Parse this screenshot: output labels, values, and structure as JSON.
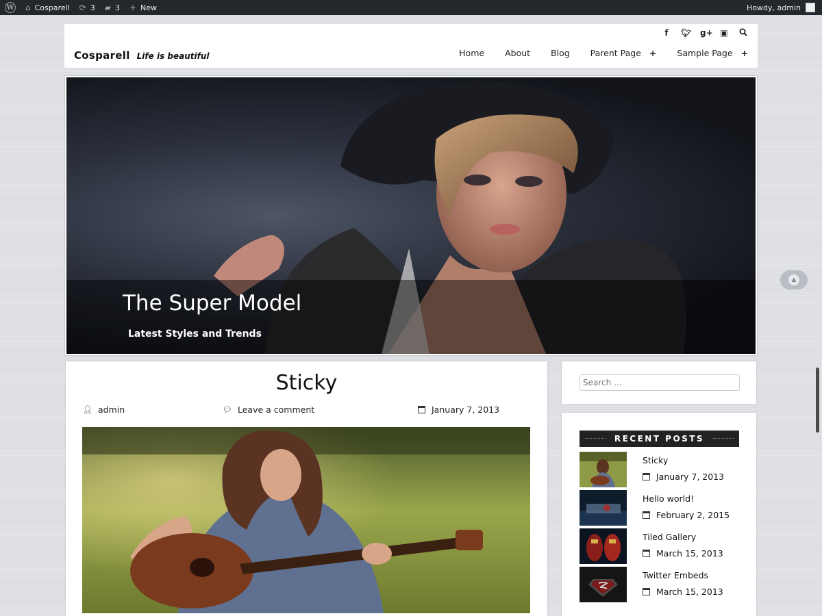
{
  "adminbar": {
    "site_name": "Cosparell",
    "updates_count": "3",
    "comments_count": "3",
    "new_label": "New",
    "greeting": "Howdy, admin"
  },
  "header": {
    "site_title": "Cosparell",
    "tagline": "Life is beautiful",
    "social_icons": [
      "facebook-icon",
      "twitter-icon",
      "google-plus-icon",
      "youtube-icon",
      "search-icon"
    ],
    "nav": [
      {
        "label": "Home"
      },
      {
        "label": "About"
      },
      {
        "label": "Blog"
      },
      {
        "label": "Parent Page",
        "expand": "+"
      },
      {
        "label": "Sample Page",
        "expand": "+"
      }
    ]
  },
  "hero": {
    "title": "The Super Model",
    "subtitle": "Latest Styles and Trends"
  },
  "post": {
    "title": "Sticky",
    "author": "admin",
    "comments": "Leave a comment",
    "date": "January 7, 2013"
  },
  "sidebar": {
    "search_placeholder": "Search …",
    "recent_heading": "RECENT POSTS",
    "recent_posts": [
      {
        "title": "Sticky",
        "date": "January 7, 2013"
      },
      {
        "title": "Hello world!",
        "date": "February 2, 2015"
      },
      {
        "title": "Tiled Gallery",
        "date": "March 15, 2013"
      },
      {
        "title": "Twitter Embeds",
        "date": "March 15, 2013"
      }
    ]
  },
  "colors": {
    "adminbar_bg": "#23282d",
    "page_bg": "#dcdde2",
    "recent_head_bg": "#222222"
  }
}
